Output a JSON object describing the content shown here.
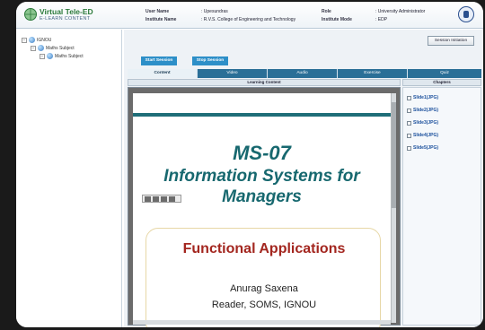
{
  "app": {
    "title": "Virtual Tele-ED",
    "subtitle": "E-LEARN CONTENT"
  },
  "header": {
    "user_label": "User Name",
    "user_value": ": Upesundras",
    "institute_label": "Institute Name",
    "institute_value": ": R.V.S. College of Engineering and Technology",
    "role_label": "Role",
    "role_value": ": University Administrator",
    "mode_label": "Institute Mode",
    "mode_value": ": EDP"
  },
  "tree": {
    "root": "IGNOU",
    "item1": "Maths Subject",
    "item2": "Maths Subject"
  },
  "main": {
    "session_button": "Session Initiation",
    "start_session": "Start Session",
    "stop_session": "Stop Session",
    "tabs": [
      {
        "label": "Content"
      },
      {
        "label": "Video"
      },
      {
        "label": "Audio"
      },
      {
        "label": "Exercise"
      },
      {
        "label": "Quiz"
      }
    ],
    "learning_content_label": "Learning Content",
    "chapters_label": "Chapters",
    "chapters": [
      {
        "label": "Slide1(JPG)"
      },
      {
        "label": "Slide2(JPG)"
      },
      {
        "label": "Slide3(JPG)"
      },
      {
        "label": "Slide4(JPG)"
      },
      {
        "label": "Slide5(JPG)"
      }
    ]
  },
  "slide": {
    "code": "MS-07",
    "title_line1": "Information Systems for",
    "title_line2": "Managers",
    "topic": "Functional Applications",
    "author": "Anurag Saxena",
    "role": "Reader, SOMS, IGNOU"
  }
}
